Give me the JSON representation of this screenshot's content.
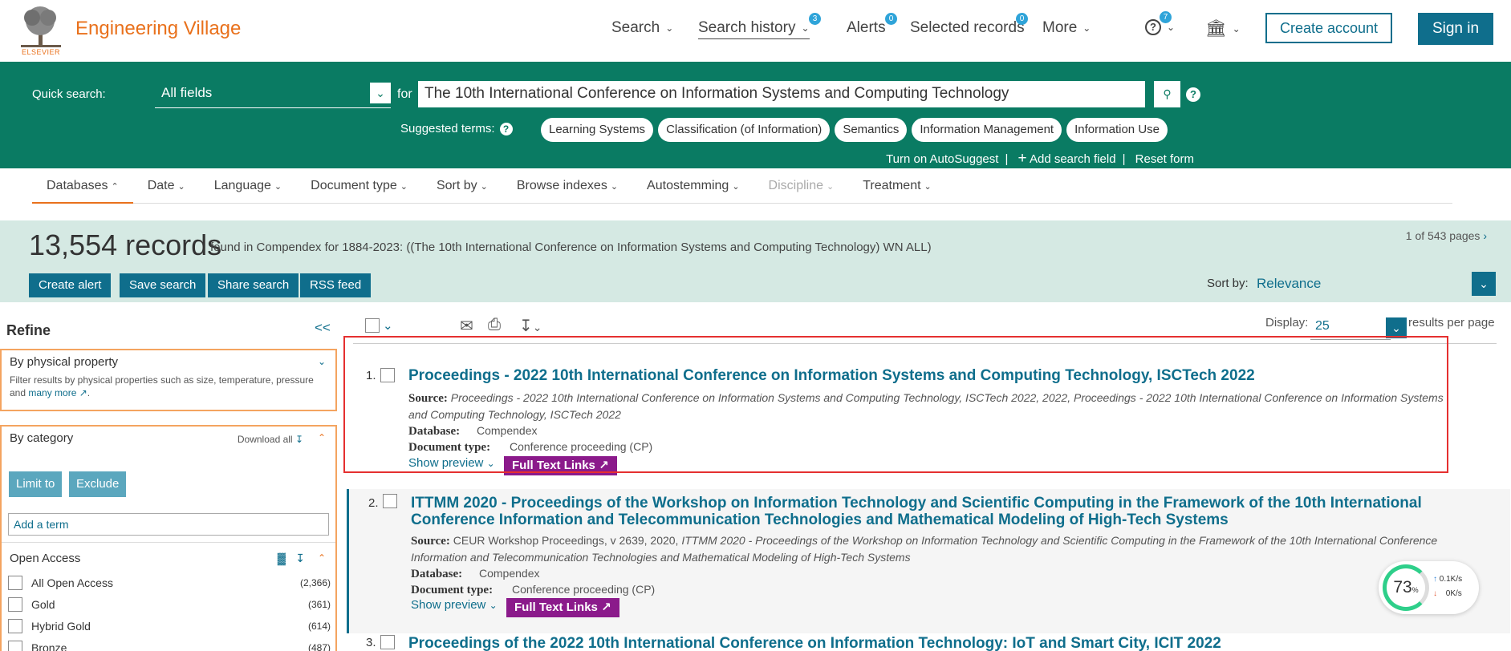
{
  "header": {
    "brand": "Engineering Village",
    "logo_caption": "ELSEVIER",
    "nav": [
      {
        "label": "Search",
        "badge": ""
      },
      {
        "label": "Search history",
        "badge": "3"
      },
      {
        "label": "Alerts",
        "badge": "0"
      },
      {
        "label": "Selected records",
        "badge": "0"
      },
      {
        "label": "More",
        "badge": ""
      }
    ],
    "help_badge": "7",
    "create_account": "Create account",
    "sign_in": "Sign in"
  },
  "quick_search": {
    "label": "Quick search:",
    "field": "All fields",
    "for": "for",
    "query": "The 10th International Conference on Information Systems and Computing Technology",
    "suggested_label": "Suggested terms:",
    "suggested_terms": [
      "Learning Systems",
      "Classification (of Information)",
      "Semantics",
      "Information Management",
      "Information Use"
    ],
    "autosuggest": "Turn on AutoSuggest",
    "add_field": "Add search field",
    "reset": "Reset form"
  },
  "tabs": [
    {
      "label": "Databases",
      "state": "active"
    },
    {
      "label": "Date",
      "state": ""
    },
    {
      "label": "Language",
      "state": ""
    },
    {
      "label": "Document type",
      "state": ""
    },
    {
      "label": "Sort by",
      "state": ""
    },
    {
      "label": "Browse indexes",
      "state": ""
    },
    {
      "label": "Autostemming",
      "state": ""
    },
    {
      "label": "Discipline",
      "state": "disabled"
    },
    {
      "label": "Treatment",
      "state": ""
    }
  ],
  "summary": {
    "count": "13,554 records",
    "found": "found in Compendex for 1884-2023: ((The 10th International Conference on Information Systems and Computing Technology) WN ALL)",
    "pages": "1 of 543 pages",
    "buttons": [
      "Create alert",
      "Save search",
      "Share search",
      "RSS feed"
    ],
    "sort_label": "Sort by:",
    "sort_value": "Relevance"
  },
  "refine": {
    "title": "Refine",
    "collapse": "<<",
    "physical": {
      "title": "By physical property",
      "desc": "Filter results by physical properties such as size, temperature, pressure and",
      "more": "many more"
    },
    "category": {
      "title": "By category",
      "download_all": "Download all",
      "limit": "Limit to",
      "exclude": "Exclude",
      "add_term": "Add a term"
    },
    "open_access": {
      "title": "Open Access",
      "items": [
        {
          "label": "All Open Access",
          "count": "(2,366)"
        },
        {
          "label": "Gold",
          "count": "(361)"
        },
        {
          "label": "Hybrid Gold",
          "count": "(614)"
        },
        {
          "label": "Bronze",
          "count": "(487)"
        }
      ]
    }
  },
  "toolbar": {
    "display_label": "Display:",
    "display_value": "25",
    "rpp": "results per page"
  },
  "results": [
    {
      "num": "1.",
      "title": "Proceedings - 2022 10th International Conference on Information Systems and Computing Technology, ISCTech 2022",
      "source_label": "Source:",
      "source": "Proceedings - 2022 10th International Conference on Information Systems and Computing Technology, ISCTech 2022, 2022, Proceedings - 2022 10th International Conference on Information Systems and Computing Technology, ISCTech 2022",
      "db_label": "Database:",
      "db": "Compendex",
      "dt_label": "Document type:",
      "dt": "Conference proceeding (CP)",
      "preview": "Show preview",
      "ftl": "Full Text Links"
    },
    {
      "num": "2.",
      "title": "ITTMM 2020 - Proceedings of the Workshop on Information Technology and Scientific Computing in the Framework of the 10th International Conference Information and Telecommunication Technologies and Mathematical Modeling of High-Tech Systems",
      "source_label": "Source:",
      "source_plain": "CEUR Workshop Proceedings, v 2639, 2020,",
      "source": "ITTMM 2020 - Proceedings of the Workshop on Information Technology and Scientific Computing in the Framework of the 10th International Conference Information and Telecommunication Technologies and Mathematical Modeling of High-Tech Systems",
      "db_label": "Database:",
      "db": "Compendex",
      "dt_label": "Document type:",
      "dt": "Conference proceeding (CP)",
      "preview": "Show preview",
      "ftl": "Full Text Links"
    },
    {
      "num": "3.",
      "title": "Proceedings of the 2022 10th International Conference on Information Technology: IoT and Smart City, ICIT 2022"
    }
  ],
  "network": {
    "percent": "73",
    "unit": "%",
    "up": "0.1K/s",
    "down": "0K/s"
  }
}
